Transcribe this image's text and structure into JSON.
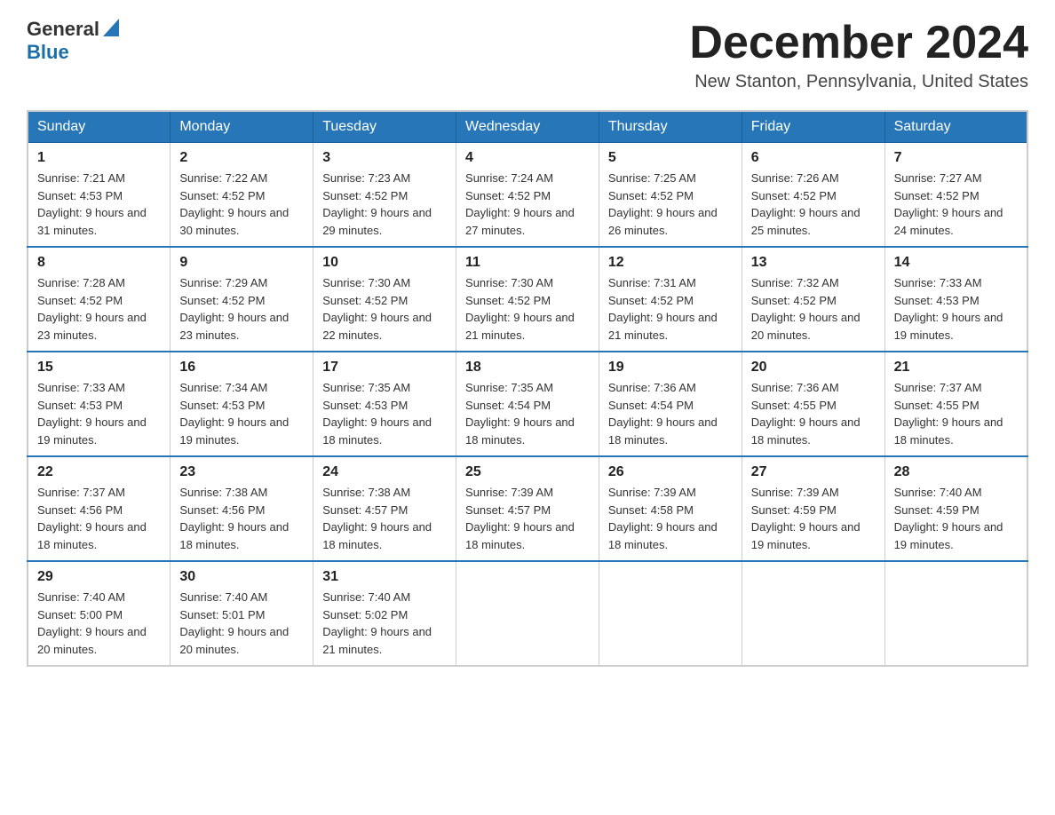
{
  "header": {
    "logo_general": "General",
    "logo_blue": "Blue",
    "month_title": "December 2024",
    "subtitle": "New Stanton, Pennsylvania, United States"
  },
  "days_of_week": [
    "Sunday",
    "Monday",
    "Tuesday",
    "Wednesday",
    "Thursday",
    "Friday",
    "Saturday"
  ],
  "weeks": [
    [
      {
        "day": "1",
        "sunrise": "Sunrise: 7:21 AM",
        "sunset": "Sunset: 4:53 PM",
        "daylight": "Daylight: 9 hours and 31 minutes."
      },
      {
        "day": "2",
        "sunrise": "Sunrise: 7:22 AM",
        "sunset": "Sunset: 4:52 PM",
        "daylight": "Daylight: 9 hours and 30 minutes."
      },
      {
        "day": "3",
        "sunrise": "Sunrise: 7:23 AM",
        "sunset": "Sunset: 4:52 PM",
        "daylight": "Daylight: 9 hours and 29 minutes."
      },
      {
        "day": "4",
        "sunrise": "Sunrise: 7:24 AM",
        "sunset": "Sunset: 4:52 PM",
        "daylight": "Daylight: 9 hours and 27 minutes."
      },
      {
        "day": "5",
        "sunrise": "Sunrise: 7:25 AM",
        "sunset": "Sunset: 4:52 PM",
        "daylight": "Daylight: 9 hours and 26 minutes."
      },
      {
        "day": "6",
        "sunrise": "Sunrise: 7:26 AM",
        "sunset": "Sunset: 4:52 PM",
        "daylight": "Daylight: 9 hours and 25 minutes."
      },
      {
        "day": "7",
        "sunrise": "Sunrise: 7:27 AM",
        "sunset": "Sunset: 4:52 PM",
        "daylight": "Daylight: 9 hours and 24 minutes."
      }
    ],
    [
      {
        "day": "8",
        "sunrise": "Sunrise: 7:28 AM",
        "sunset": "Sunset: 4:52 PM",
        "daylight": "Daylight: 9 hours and 23 minutes."
      },
      {
        "day": "9",
        "sunrise": "Sunrise: 7:29 AM",
        "sunset": "Sunset: 4:52 PM",
        "daylight": "Daylight: 9 hours and 23 minutes."
      },
      {
        "day": "10",
        "sunrise": "Sunrise: 7:30 AM",
        "sunset": "Sunset: 4:52 PM",
        "daylight": "Daylight: 9 hours and 22 minutes."
      },
      {
        "day": "11",
        "sunrise": "Sunrise: 7:30 AM",
        "sunset": "Sunset: 4:52 PM",
        "daylight": "Daylight: 9 hours and 21 minutes."
      },
      {
        "day": "12",
        "sunrise": "Sunrise: 7:31 AM",
        "sunset": "Sunset: 4:52 PM",
        "daylight": "Daylight: 9 hours and 21 minutes."
      },
      {
        "day": "13",
        "sunrise": "Sunrise: 7:32 AM",
        "sunset": "Sunset: 4:52 PM",
        "daylight": "Daylight: 9 hours and 20 minutes."
      },
      {
        "day": "14",
        "sunrise": "Sunrise: 7:33 AM",
        "sunset": "Sunset: 4:53 PM",
        "daylight": "Daylight: 9 hours and 19 minutes."
      }
    ],
    [
      {
        "day": "15",
        "sunrise": "Sunrise: 7:33 AM",
        "sunset": "Sunset: 4:53 PM",
        "daylight": "Daylight: 9 hours and 19 minutes."
      },
      {
        "day": "16",
        "sunrise": "Sunrise: 7:34 AM",
        "sunset": "Sunset: 4:53 PM",
        "daylight": "Daylight: 9 hours and 19 minutes."
      },
      {
        "day": "17",
        "sunrise": "Sunrise: 7:35 AM",
        "sunset": "Sunset: 4:53 PM",
        "daylight": "Daylight: 9 hours and 18 minutes."
      },
      {
        "day": "18",
        "sunrise": "Sunrise: 7:35 AM",
        "sunset": "Sunset: 4:54 PM",
        "daylight": "Daylight: 9 hours and 18 minutes."
      },
      {
        "day": "19",
        "sunrise": "Sunrise: 7:36 AM",
        "sunset": "Sunset: 4:54 PM",
        "daylight": "Daylight: 9 hours and 18 minutes."
      },
      {
        "day": "20",
        "sunrise": "Sunrise: 7:36 AM",
        "sunset": "Sunset: 4:55 PM",
        "daylight": "Daylight: 9 hours and 18 minutes."
      },
      {
        "day": "21",
        "sunrise": "Sunrise: 7:37 AM",
        "sunset": "Sunset: 4:55 PM",
        "daylight": "Daylight: 9 hours and 18 minutes."
      }
    ],
    [
      {
        "day": "22",
        "sunrise": "Sunrise: 7:37 AM",
        "sunset": "Sunset: 4:56 PM",
        "daylight": "Daylight: 9 hours and 18 minutes."
      },
      {
        "day": "23",
        "sunrise": "Sunrise: 7:38 AM",
        "sunset": "Sunset: 4:56 PM",
        "daylight": "Daylight: 9 hours and 18 minutes."
      },
      {
        "day": "24",
        "sunrise": "Sunrise: 7:38 AM",
        "sunset": "Sunset: 4:57 PM",
        "daylight": "Daylight: 9 hours and 18 minutes."
      },
      {
        "day": "25",
        "sunrise": "Sunrise: 7:39 AM",
        "sunset": "Sunset: 4:57 PM",
        "daylight": "Daylight: 9 hours and 18 minutes."
      },
      {
        "day": "26",
        "sunrise": "Sunrise: 7:39 AM",
        "sunset": "Sunset: 4:58 PM",
        "daylight": "Daylight: 9 hours and 18 minutes."
      },
      {
        "day": "27",
        "sunrise": "Sunrise: 7:39 AM",
        "sunset": "Sunset: 4:59 PM",
        "daylight": "Daylight: 9 hours and 19 minutes."
      },
      {
        "day": "28",
        "sunrise": "Sunrise: 7:40 AM",
        "sunset": "Sunset: 4:59 PM",
        "daylight": "Daylight: 9 hours and 19 minutes."
      }
    ],
    [
      {
        "day": "29",
        "sunrise": "Sunrise: 7:40 AM",
        "sunset": "Sunset: 5:00 PM",
        "daylight": "Daylight: 9 hours and 20 minutes."
      },
      {
        "day": "30",
        "sunrise": "Sunrise: 7:40 AM",
        "sunset": "Sunset: 5:01 PM",
        "daylight": "Daylight: 9 hours and 20 minutes."
      },
      {
        "day": "31",
        "sunrise": "Sunrise: 7:40 AM",
        "sunset": "Sunset: 5:02 PM",
        "daylight": "Daylight: 9 hours and 21 minutes."
      },
      null,
      null,
      null,
      null
    ]
  ]
}
